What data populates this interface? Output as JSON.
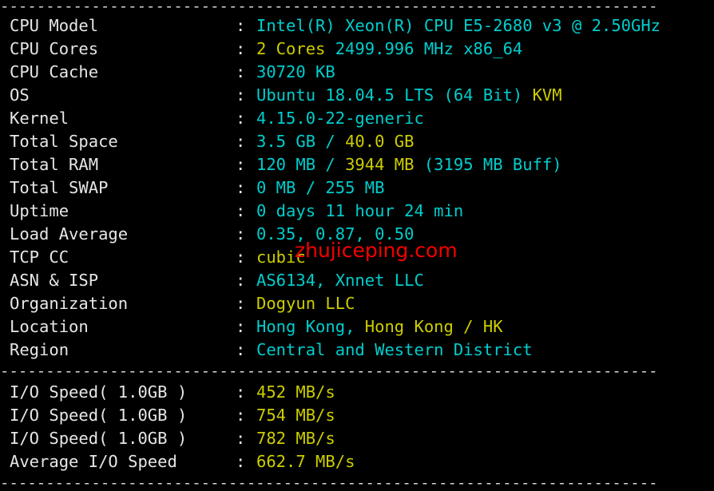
{
  "terminal": {
    "background": "#000000",
    "colors": {
      "label": "#e6e6e6",
      "cyan": "#00cdcd",
      "yellow": "#cdcd00",
      "watermark": "#f40000"
    },
    "separator": "------------------------------------------------------------------------",
    "colon": ":"
  },
  "watermark": {
    "text": "zhujiceping.com"
  },
  "system_info": {
    "rows": [
      {
        "label": "CPU Model",
        "segments": [
          {
            "text": "Intel(R) Xeon(R) CPU E5-2680 v3 @ 2.50GHz",
            "color": "cyan"
          }
        ]
      },
      {
        "label": "CPU Cores",
        "segments": [
          {
            "text": "2 Cores",
            "color": "yellow"
          },
          {
            "text": " 2499.996 MHz x86_64",
            "color": "cyan"
          }
        ]
      },
      {
        "label": "CPU Cache",
        "segments": [
          {
            "text": "30720 KB",
            "color": "cyan"
          }
        ]
      },
      {
        "label": "OS",
        "segments": [
          {
            "text": "Ubuntu 18.04.5 LTS (64 Bit) ",
            "color": "cyan"
          },
          {
            "text": "KVM",
            "color": "yellow"
          }
        ]
      },
      {
        "label": "Kernel",
        "segments": [
          {
            "text": "4.15.0-22-generic",
            "color": "cyan"
          }
        ]
      },
      {
        "label": "Total Space",
        "segments": [
          {
            "text": "3.5 GB / ",
            "color": "cyan"
          },
          {
            "text": "40.0 GB",
            "color": "yellow"
          }
        ]
      },
      {
        "label": "Total RAM",
        "segments": [
          {
            "text": "120 MB / ",
            "color": "cyan"
          },
          {
            "text": "3944 MB",
            "color": "yellow"
          },
          {
            "text": " (3195 MB Buff)",
            "color": "cyan"
          }
        ]
      },
      {
        "label": "Total SWAP",
        "segments": [
          {
            "text": "0 MB / 255 MB",
            "color": "cyan"
          }
        ]
      },
      {
        "label": "Uptime",
        "segments": [
          {
            "text": "0 days 11 hour 24 min",
            "color": "cyan"
          }
        ]
      },
      {
        "label": "Load Average",
        "segments": [
          {
            "text": "0.35, 0.87, 0.50",
            "color": "cyan"
          }
        ]
      },
      {
        "label": "TCP CC",
        "segments": [
          {
            "text": "cubic",
            "color": "yellow"
          }
        ]
      },
      {
        "label": "ASN & ISP",
        "segments": [
          {
            "text": "AS6134, Xnnet LLC",
            "color": "cyan"
          }
        ]
      },
      {
        "label": "Organization",
        "segments": [
          {
            "text": "Dogyun LLC",
            "color": "yellow"
          }
        ]
      },
      {
        "label": "Location",
        "segments": [
          {
            "text": "Hong Kong, ",
            "color": "cyan"
          },
          {
            "text": "Hong Kong / HK",
            "color": "yellow"
          }
        ]
      },
      {
        "label": "Region",
        "segments": [
          {
            "text": "Central and Western District",
            "color": "cyan"
          }
        ]
      }
    ]
  },
  "io_results": {
    "rows": [
      {
        "label": "I/O Speed( 1.0GB )",
        "segments": [
          {
            "text": "452 MB/s",
            "color": "yellow"
          }
        ]
      },
      {
        "label": "I/O Speed( 1.0GB )",
        "segments": [
          {
            "text": "754 MB/s",
            "color": "yellow"
          }
        ]
      },
      {
        "label": "I/O Speed( 1.0GB )",
        "segments": [
          {
            "text": "782 MB/s",
            "color": "yellow"
          }
        ]
      },
      {
        "label": "Average I/O Speed",
        "segments": [
          {
            "text": "662.7 MB/s",
            "color": "yellow"
          }
        ]
      }
    ]
  }
}
